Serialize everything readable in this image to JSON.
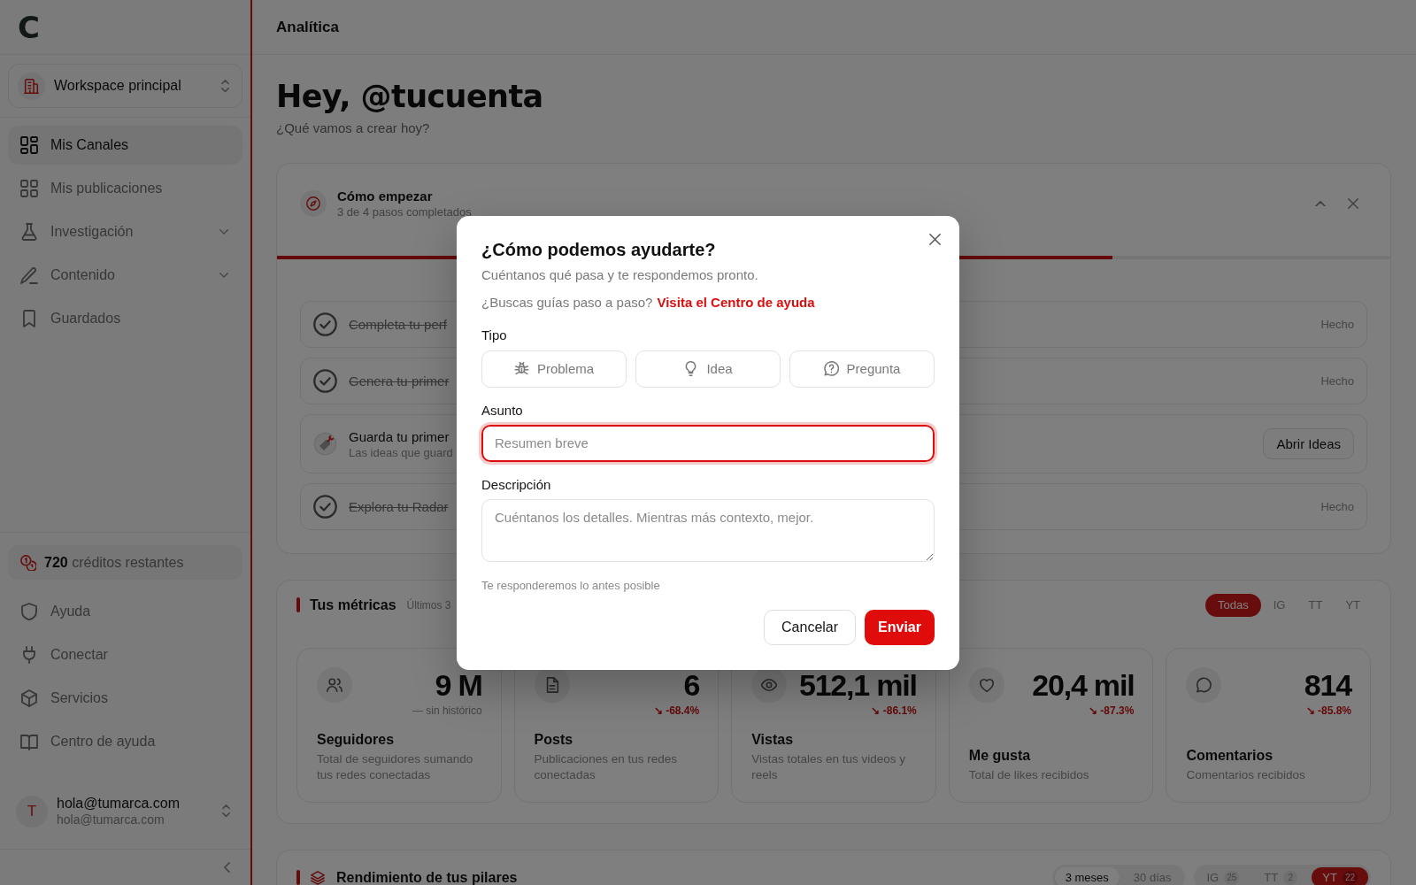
{
  "sidebar": {
    "logo": "C",
    "workspace": {
      "name": "Workspace principal"
    },
    "nav": [
      {
        "label": "Mis Canales",
        "kind": "link",
        "selected": true
      },
      {
        "label": "Mis publicaciones",
        "kind": "link",
        "selected": false
      },
      {
        "label": "Investigación",
        "kind": "group",
        "selected": false,
        "expanded": false
      },
      {
        "label": "Contenido",
        "kind": "group",
        "selected": false,
        "expanded": false
      },
      {
        "label": "Guardados",
        "kind": "link",
        "selected": false
      }
    ],
    "credits": {
      "text": "**720** créditos restantes"
    },
    "secondary_nav": [
      {
        "label": "Ayuda",
        "selected": false
      },
      {
        "label": "Conectar",
        "selected": false
      },
      {
        "label": "Servicios",
        "selected": false
      },
      {
        "label": "Centro de ayuda",
        "selected": false
      }
    ],
    "user": {
      "initial": "T",
      "name": "hola@tumarca.com",
      "email": "hola@tumarca.com"
    }
  },
  "header": {
    "title": "Analítica"
  },
  "greeting": {
    "title": "Hey, @tucuenta",
    "subtitle": "¿Qué vamos a crear hoy?"
  },
  "onboarding": {
    "title": "Cómo empezar",
    "subtitle": "3 de 4 pasos completados",
    "expanded": true,
    "level": 0.75,
    "steps": [
      {
        "title": "Completa tu perf",
        "done": true,
        "status": "Hecho"
      },
      {
        "title": "Genera tu primer",
        "done": true,
        "status": "Hecho"
      },
      {
        "title": "Guarda tu primer",
        "description": "Las ideas que guard",
        "done": false,
        "action": "Abrir Ideas"
      },
      {
        "title": "Explora tu Radar",
        "done": true,
        "status": "Hecho"
      }
    ]
  },
  "metrics": {
    "title": "Tus métricas",
    "period": "Últimos 3",
    "filters": [
      {
        "label": "Todas",
        "selected": true
      },
      {
        "label": "IG",
        "selected": false
      },
      {
        "label": "TT",
        "selected": false
      },
      {
        "label": "YT",
        "selected": false
      }
    ],
    "cards": [
      {
        "value": "9 M",
        "note": "— sin histórico",
        "title": "Seguidores",
        "description": "Total de seguidores sumando tus redes conectadas"
      },
      {
        "value": "6",
        "change": "↘ -68.4%",
        "title": "Posts",
        "description": "Publicaciones en tus redes conectadas"
      },
      {
        "value": "512,1 mil",
        "change": "↘ -86.1%",
        "title": "Vistas",
        "description": "Vistas totales en tus videos y reels"
      },
      {
        "value": "20,4 mil",
        "change": "↘ -87.3%",
        "title": "Me gusta",
        "description": "Total de likes recibidos"
      },
      {
        "value": "814",
        "change": "↘ -85.8%",
        "title": "Comentarios",
        "description": "Comentarios recibidos"
      }
    ]
  },
  "pillars": {
    "title": "Rendimiento de tus pilares",
    "ranges": [
      {
        "label": "3 meses",
        "selected": true
      },
      {
        "label": "30 días",
        "selected": false
      }
    ],
    "networks": [
      {
        "label": "IG",
        "count": "25",
        "selected": false
      },
      {
        "label": "TT",
        "count": "2",
        "selected": false
      },
      {
        "label": "YT",
        "count": "22",
        "selected": true
      }
    ]
  },
  "modal": {
    "title": "¿Cómo podemos ayudarte?",
    "subtitle": "Cuéntanos qué pasa y te respondemos pronto.",
    "help_prompt": "¿Buscas guías paso a paso?",
    "help_link": "Visita el Centro de ayuda",
    "type_label": "Tipo",
    "types": [
      {
        "label": "Problema",
        "selected": false
      },
      {
        "label": "Idea",
        "selected": false
      },
      {
        "label": "Pregunta",
        "selected": false
      }
    ],
    "subject": {
      "label": "Asunto",
      "placeholder": "Resumen breve",
      "focused": true
    },
    "description": {
      "label": "Descripción",
      "placeholder": "Cuéntanos los detalles. Mientras más contexto, mejor."
    },
    "hint": "Te responderemos lo antes posible",
    "buttons": [
      {
        "label": "Cancelar",
        "kind": "secondary"
      },
      {
        "label": "Enviar",
        "kind": "primary"
      }
    ]
  }
}
